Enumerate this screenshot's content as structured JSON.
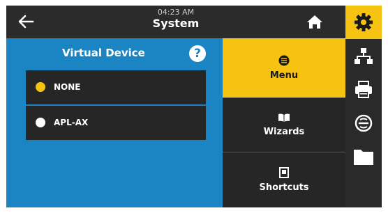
{
  "header": {
    "time": "04:23 AM",
    "title": "System"
  },
  "panel": {
    "title": "Virtual Device",
    "help_label": "?",
    "options": [
      {
        "label": "NONE",
        "selected": true
      },
      {
        "label": "APL-AX",
        "selected": false
      }
    ]
  },
  "menu": {
    "items": [
      {
        "label": "Menu",
        "icon": "menu-circle-icon",
        "active": true
      },
      {
        "label": "Wizards",
        "icon": "book-icon",
        "active": false
      },
      {
        "label": "Shortcuts",
        "icon": "bookmark-icon",
        "active": false
      }
    ]
  },
  "toolbar": {
    "items": [
      {
        "icon": "gear-icon",
        "active": true
      },
      {
        "icon": "network-icon",
        "active": false
      },
      {
        "icon": "printer-icon",
        "active": false
      },
      {
        "icon": "rfid-icon",
        "active": false
      },
      {
        "icon": "folder-icon",
        "active": false
      }
    ]
  },
  "colors": {
    "accent": "#f7c313",
    "panel": "#1b84c2",
    "dark": "#262626"
  }
}
